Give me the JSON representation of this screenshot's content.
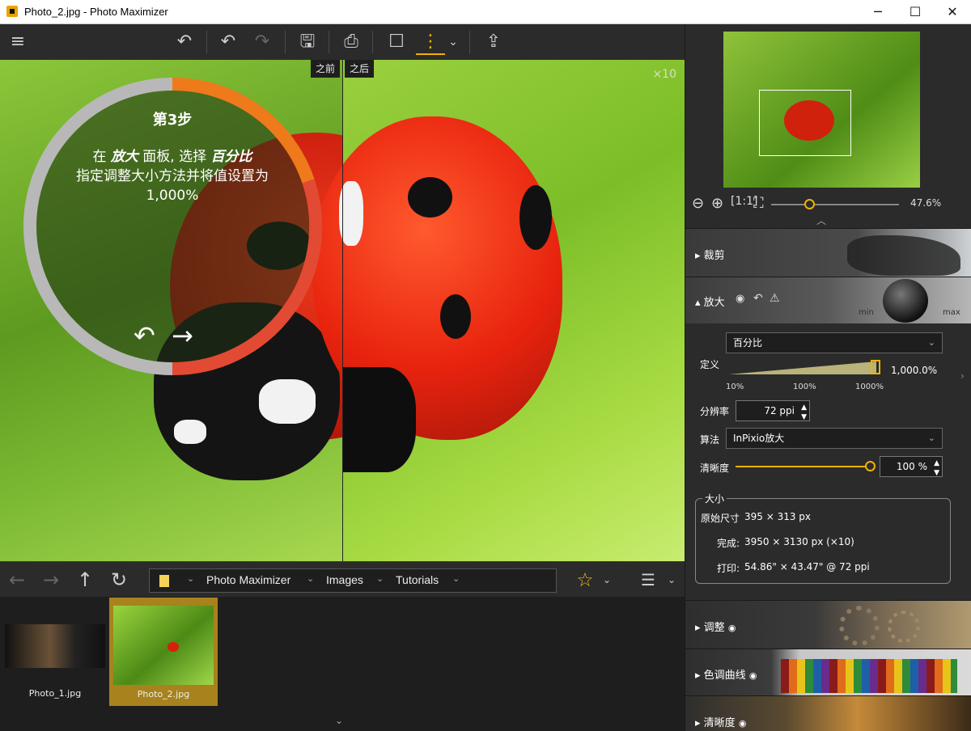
{
  "window": {
    "title": "Photo_2.jpg - Photo Maximizer",
    "min": "─",
    "max": "☐",
    "close": "✕"
  },
  "toolbar": {
    "menu": "≡",
    "undo_all": "↶",
    "undo": "↶",
    "redo": "↷",
    "save": "🖫",
    "print": "⎙",
    "single_view": "☐",
    "split_view": "⋮",
    "share": "⇪",
    "dropdown": "⌄"
  },
  "viewer": {
    "before_label": "之前",
    "after_label": "之后",
    "zoom_label": "×10"
  },
  "guide": {
    "step": "第3步",
    "line1_pre": "在 ",
    "line1_b1": "放大",
    "line1_mid": " 面板, 选择 ",
    "line1_b2": "百分比",
    "line2": "指定调整大小方法并将值设置为",
    "line3": "1,000%",
    "prev": "↶",
    "next": "→"
  },
  "navbar": {
    "back": "←",
    "forward": "→",
    "up": "↑",
    "refresh": "↻",
    "folder": "📁",
    "crumbs": [
      "Photo Maximizer",
      "Images",
      "Tutorials"
    ],
    "favorite": "☆",
    "sort": "☰"
  },
  "filmstrip": {
    "items": [
      {
        "name": "Photo_1.jpg"
      },
      {
        "name": "Photo_2.jpg"
      }
    ],
    "collapse": "⌄"
  },
  "navigator": {
    "zoom_percent": "47.6%",
    "zoom_level": 0.3
  },
  "sections": {
    "crop": "裁剪",
    "magnify": "放大",
    "adjust": "调整",
    "curves": "色调曲线",
    "sharpness": "清晰度",
    "knob_min": "min",
    "knob_max": "max"
  },
  "magnify": {
    "method": "百分比",
    "define_label": "定义",
    "define_value": "1,000.0%",
    "define_level": 1.0,
    "ticks": [
      "10%",
      "100%",
      "1000%"
    ],
    "resolution_label": "分辨率",
    "resolution_value": "72 ppi",
    "algorithm_label": "算法",
    "algorithm_value": "InPixio放大",
    "sharpness_label": "清晰度",
    "sharpness_value": "100 %",
    "sharpness_level": 1.0,
    "size_group": "大小",
    "original_label": "原始尺寸",
    "original_value": "395 × 313 px",
    "result_label": "完成:",
    "result_value": "3950 × 3130 px (×10)",
    "print_label": "打印:",
    "print_value": "54.86\" × 43.47\" @ 72 ppi"
  },
  "colors": {
    "accent": "#f0b400",
    "bg": "#2b2b2b",
    "selected_thumb": "#a8821c"
  }
}
